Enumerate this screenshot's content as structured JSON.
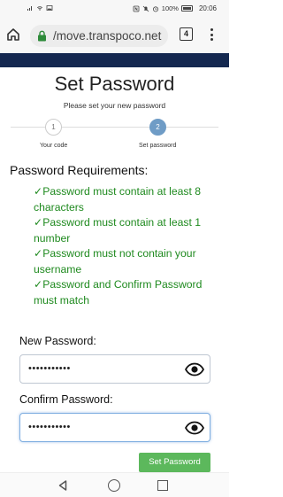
{
  "status_bar": {
    "left_icons": [
      "signal-icon",
      "wifi-icon",
      "gallery-icon"
    ],
    "right_icons": [
      "nfc-icon",
      "mute-icon",
      "alarm-icon"
    ],
    "battery": "100%",
    "time": "20:06"
  },
  "browser": {
    "url": "/move.transpoco.net",
    "tab_count": "4",
    "icons": [
      "home-icon",
      "lock-icon",
      "menu-icon"
    ]
  },
  "page": {
    "title": "Set Password",
    "subtitle": "Please set your new password"
  },
  "stepper": {
    "steps": [
      {
        "number": "1",
        "label": "Your code"
      },
      {
        "number": "2",
        "label": "Set password"
      }
    ],
    "active_step": 2
  },
  "requirements": {
    "title": "Password Requirements:",
    "items": [
      "✓Password must contain at least 8 characters",
      "✓Password must contain at least 1 number",
      "✓Password must not contain your username",
      "✓Password and Confirm Password must match"
    ],
    "color": "#1f8a1f"
  },
  "form": {
    "new_password_label": "New Password:",
    "new_password_value": "•••••••••••",
    "confirm_password_label": "Confirm Password:",
    "confirm_password_value": "•••••••••••",
    "submit_label": "Set Password"
  },
  "colors": {
    "header_band": "#142850",
    "submit": "#5cb85c",
    "active_step": "#6f9cc6"
  }
}
